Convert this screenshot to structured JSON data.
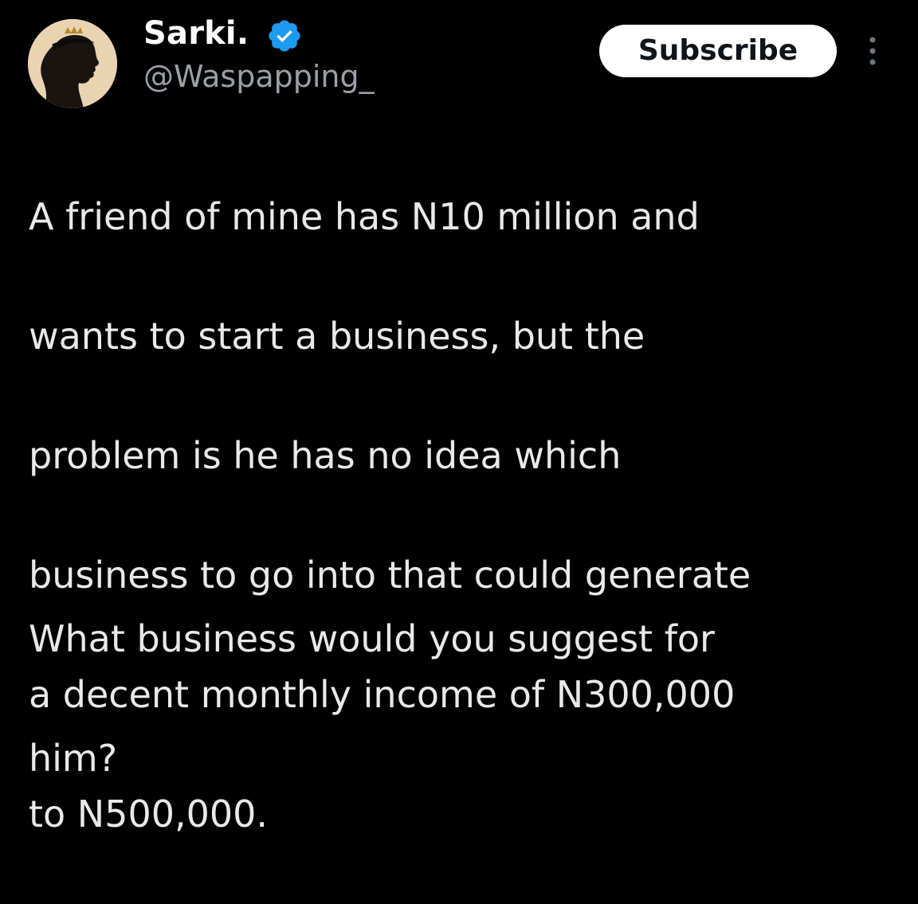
{
  "author": {
    "display_name": "Sarki.",
    "handle": "@Waspapping_",
    "avatar_icon": "silhouette-portrait-icon",
    "verified_icon": "verified-badge-icon"
  },
  "actions": {
    "subscribe_label": "Subscribe",
    "more_icon": "more-vertical-icon"
  },
  "tweet": {
    "text_lines": [
      "A friend of mine has N10 million and",
      "wants to start a business, but the",
      "problem is he has no idea which",
      "business to go into that could generate",
      "a decent monthly income of N300,000",
      "to N500,000."
    ],
    "question_lines": [
      "What business would you suggest for",
      "him?"
    ]
  },
  "colors": {
    "background": "#000000",
    "text": "#e7e9ea",
    "handle": "#9aa0a6",
    "verified": "#1d9bf0",
    "button_bg": "#ffffff",
    "button_text": "#0f1419"
  }
}
